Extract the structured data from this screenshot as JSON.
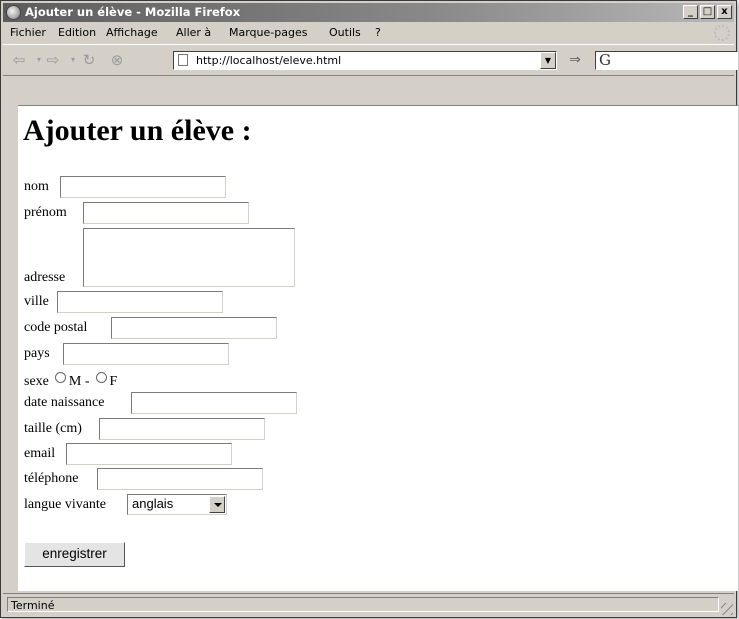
{
  "window": {
    "title": "Ajouter un élève - Mozilla Firefox",
    "minimize": "_",
    "maximize": "□",
    "close": "x"
  },
  "menu": {
    "items": [
      "Fichier",
      "Edition",
      "Affichage",
      "Aller à",
      "Marque-pages",
      "Outils",
      "?"
    ]
  },
  "navbar": {
    "url": "http://localhost/eleve.html",
    "search_value": "G"
  },
  "page": {
    "heading": "Ajouter un élève :",
    "fields": {
      "nom": "nom",
      "prenom": "prénom",
      "adresse": "adresse",
      "ville": "ville",
      "code_postal": "code postal",
      "pays": "pays",
      "sexe": "sexe",
      "sexe_m": "M -",
      "sexe_f": "F",
      "date_naissance": "date naissance",
      "taille": "taille (cm)",
      "email": "email",
      "telephone": "téléphone",
      "langue": "langue vivante"
    },
    "langue_selected": "anglais",
    "submit_label": "enregistrer"
  },
  "status": {
    "text": "Terminé"
  }
}
